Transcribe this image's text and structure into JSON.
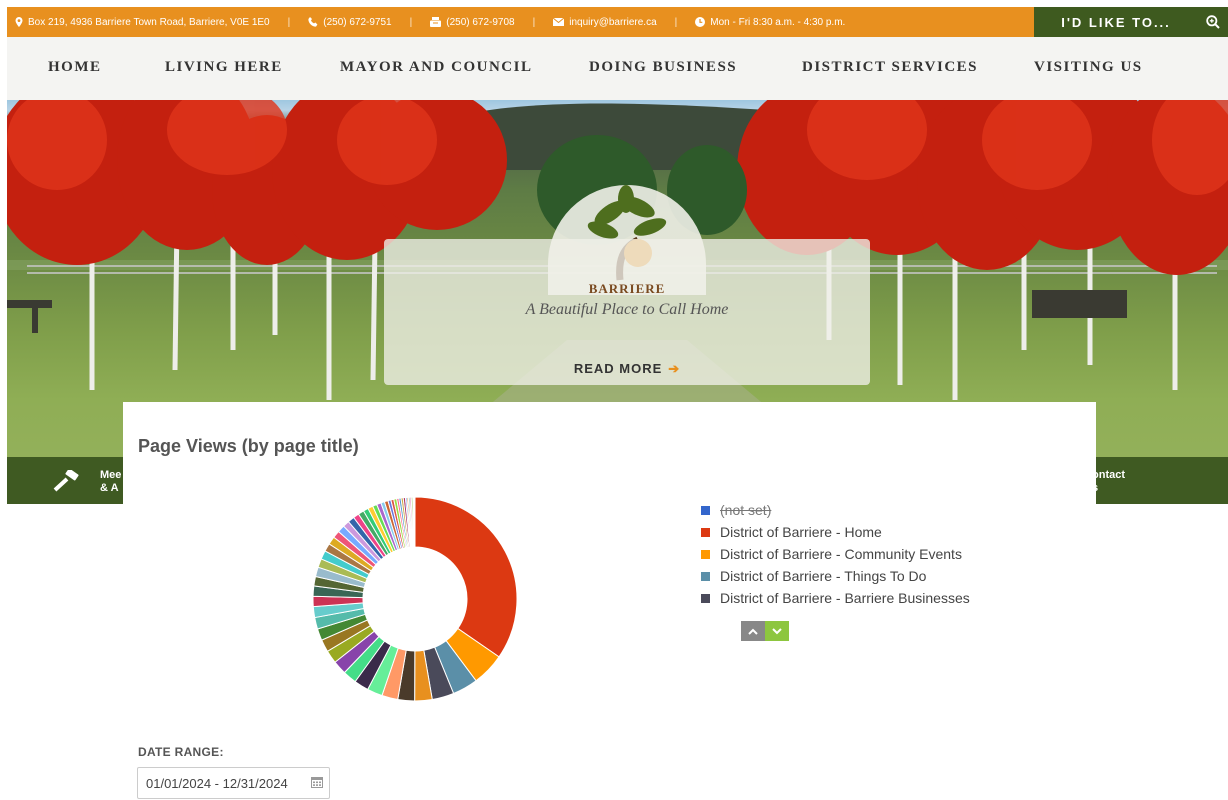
{
  "topbar": {
    "address": "Box 219, 4936 Barriere Town Road, Barriere, V0E 1E0",
    "phone": "(250) 672-9751",
    "fax": "(250) 672-9708",
    "email": "inquiry@barriere.ca",
    "hours": "Mon - Fri 8:30 a.m. - 4:30 p.m.",
    "cta": "I'D LIKE TO...",
    "accent": "#e8901f",
    "dark_green": "#3e5a1f"
  },
  "nav": {
    "items": [
      "HOME",
      "LIVING HERE",
      "MAYOR AND COUNCIL",
      "DOING BUSINESS",
      "DISTRICT SERVICES",
      "VISITING US"
    ]
  },
  "hero": {
    "brand": "BARRIERE",
    "tagline": "A Beautiful Place to Call Home",
    "read_more": "READ MORE"
  },
  "band": {
    "left_text_1": "Mee",
    "left_text_2": "& A",
    "right_text_1": "ontact",
    "right_text_2": "s"
  },
  "report": {
    "title": "Page Views (by page title)",
    "date_label": "DATE RANGE:",
    "date_value": "01/01/2024 - 12/31/2024"
  },
  "chart_data": {
    "type": "pie",
    "title": "Page Views (by page title)",
    "legend_placement": "right",
    "series": [
      {
        "name": "(not set)",
        "value": 0,
        "color": "#3366cc",
        "hidden": true
      },
      {
        "name": "District of Barriere - Home",
        "value": 30,
        "color": "#dc3912"
      },
      {
        "name": "District of Barriere - Community Events",
        "value": 4.5,
        "color": "#ff9900"
      },
      {
        "name": "District of Barriere - Things To Do",
        "value": 3.5,
        "color": "#5b8fa8"
      },
      {
        "name": "District of Barriere - Barriere Businesses",
        "value": 3,
        "color": "#4a4a5a"
      }
    ],
    "other_slices": [
      2.4,
      2.3,
      2.2,
      2.1,
      2.0,
      1.9,
      1.9,
      1.8,
      1.7,
      1.6,
      1.6,
      1.5,
      1.4,
      1.4,
      1.3,
      1.3,
      1.2,
      1.2,
      1.1,
      1.1,
      1.0,
      1.0,
      0.9,
      0.9,
      0.8,
      0.8,
      0.7,
      0.7,
      0.6,
      0.6,
      0.5,
      0.5,
      0.4,
      0.4,
      0.4,
      0.3,
      0.3,
      0.3,
      0.3,
      0.2,
      0.2,
      0.2,
      0.2,
      0.2,
      0.1,
      0.1,
      0.1
    ],
    "other_colors": [
      "#e8901f",
      "#4a3a2a",
      "#ff9966",
      "#66ee99",
      "#3a2a4a",
      "#44dd88",
      "#8844aa",
      "#99aa22",
      "#997722",
      "#448833",
      "#55bbaa",
      "#66cccc",
      "#cc3355",
      "#3a6655",
      "#556633",
      "#99bbcc",
      "#aabb55",
      "#44cccc",
      "#aa7744",
      "#ddaa22",
      "#ee5577",
      "#77aaff",
      "#cc99dd",
      "#3366aa",
      "#ee4488",
      "#44aa66",
      "#33cc77",
      "#ffcc33",
      "#66dd55",
      "#aa66cc",
      "#88ccee",
      "#cc6633",
      "#6677dd",
      "#dd5544",
      "#99dd44",
      "#ff6688",
      "#5599cc",
      "#ccaa44",
      "#aa3366",
      "#4488ee",
      "#ee8833",
      "#66aa99",
      "#dd66aa",
      "#88bb33",
      "#cc4444",
      "#557799",
      "#bb8855"
    ]
  }
}
